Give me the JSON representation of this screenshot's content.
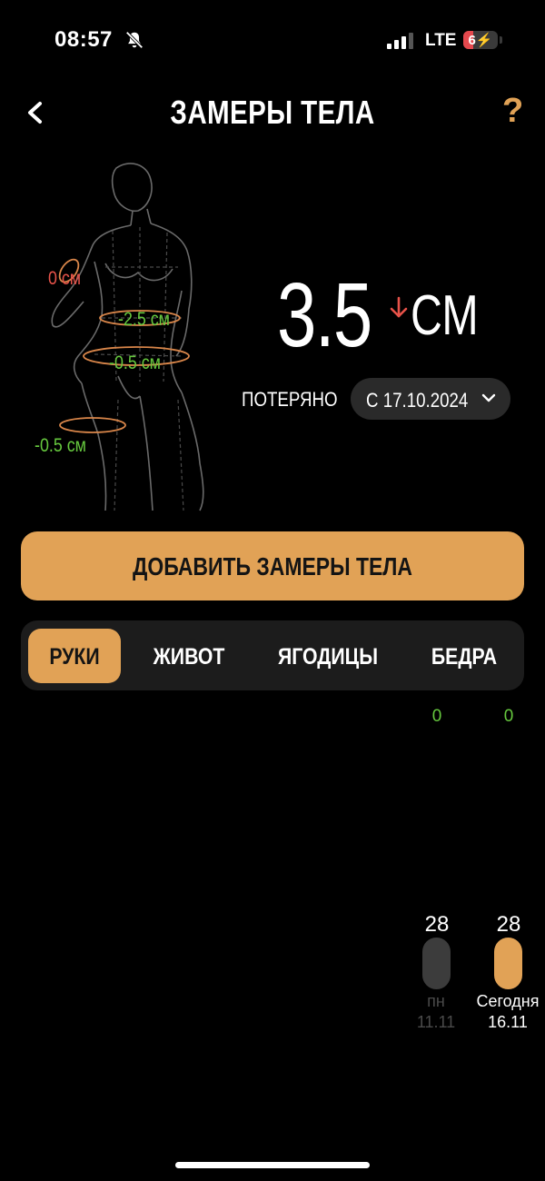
{
  "status": {
    "time": "08:57",
    "network": "LTE",
    "battery": "6",
    "battery_level_percent": 6
  },
  "header": {
    "title": "ЗАМЕРЫ ТЕЛА",
    "help": "?",
    "back_icon": "chevron-left-icon",
    "accent_color": "#e1a256"
  },
  "figure": {
    "measurements": [
      {
        "label": "0 см",
        "status": "red"
      },
      {
        "label": "-2.5 см",
        "status": "green"
      },
      {
        "label": "-0.5 см",
        "status": "green"
      },
      {
        "label": "-0.5 см",
        "status": "green"
      }
    ]
  },
  "summary": {
    "value": "3.5",
    "unit": "СМ",
    "trend": "down",
    "lost_label": "ПОТЕРЯНО",
    "date_range": "С 17.10.2024"
  },
  "add_button": {
    "label": "ДОБАВИТЬ ЗАМЕРЫ ТЕЛА"
  },
  "tabs": [
    {
      "label": "РУКИ",
      "active": true
    },
    {
      "label": "ЖИВОТ",
      "active": false
    },
    {
      "label": "ЯГОДИЦЫ",
      "active": false
    },
    {
      "label": "БЕДРА",
      "active": false
    }
  ],
  "chart_data": {
    "type": "bar",
    "categories": [
      "пн 11.11",
      "Сегодня 16.11"
    ],
    "values": [
      28,
      28
    ],
    "deltas": [
      "0",
      "0"
    ],
    "days": [
      {
        "day": "пн",
        "date": "11.11",
        "value": "28",
        "delta": "0"
      },
      {
        "day": "Сегодня",
        "date": "16.11",
        "value": "28",
        "delta": "0"
      }
    ]
  }
}
